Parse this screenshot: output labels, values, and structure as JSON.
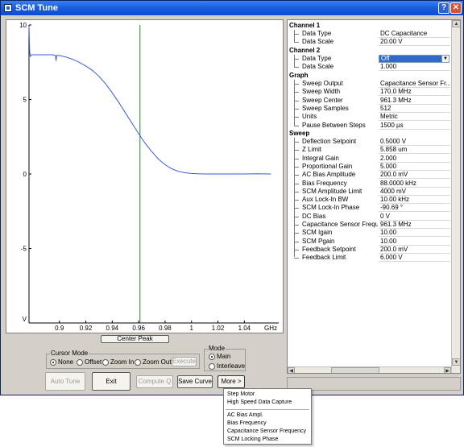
{
  "window": {
    "title": "SCM Tune",
    "help_label": "?",
    "close_label": "✕",
    "icon": "scm-app-icon"
  },
  "plot": {
    "center_peak_label": "Center Peak",
    "line_color": "#3a5bd9",
    "marker_color": "#1a8c1a"
  },
  "chart_data": {
    "type": "line",
    "xlabel": "GHz",
    "ylabel": "V",
    "xlim": [
      0.877,
      1.066
    ],
    "ylim": [
      -10,
      10
    ],
    "x_ticks": [
      "0.9",
      "0.92",
      "0.94",
      "0.96",
      "0.98",
      "1",
      "1.02",
      "1.04"
    ],
    "y_ticks": [
      "10",
      "5",
      "0",
      "-5"
    ],
    "cursor_x": 0.961,
    "series": [
      {
        "x": [
          0.877,
          0.8775,
          0.878,
          0.879,
          0.88,
          0.885,
          0.89,
          0.895,
          0.897,
          0.8975,
          0.898,
          0.9,
          0.905,
          0.91,
          0.915,
          0.92,
          0.925,
          0.93,
          0.935,
          0.94,
          0.945,
          0.95,
          0.955,
          0.96,
          0.965,
          0.97,
          0.975,
          0.98,
          0.985,
          0.99,
          0.995,
          1.0,
          1.005,
          1.01,
          1.015,
          1.02,
          1.03,
          1.04,
          1.05,
          1.06
        ],
        "y": [
          9.9,
          8.2,
          7.9,
          8.0,
          8.0,
          8.0,
          8.0,
          8.0,
          7.95,
          7.6,
          7.95,
          7.95,
          7.85,
          7.7,
          7.5,
          7.25,
          6.95,
          6.55,
          6.05,
          5.45,
          4.8,
          4.1,
          3.4,
          2.7,
          2.05,
          1.5,
          1.0,
          0.62,
          0.35,
          0.18,
          0.08,
          0.03,
          0.01,
          0.0,
          0.0,
          0.0,
          0.0,
          0.0,
          0.01,
          0.0
        ]
      }
    ]
  },
  "cursor_mode": {
    "title": "Cursor Mode",
    "options": [
      "None",
      "Offset",
      "Zoom In",
      "Zoom Out"
    ],
    "selected": "None",
    "execute_label": "Execute"
  },
  "mode": {
    "title": "Mode",
    "options": [
      "Main",
      "Interleave"
    ],
    "selected": "Main"
  },
  "buttons": {
    "auto_tune": "Auto Tune",
    "exit": "Exit",
    "compute_q": "Compute Q",
    "save_curve": "Save Curve",
    "more": "More >"
  },
  "properties": {
    "channel1": {
      "title": "Channel 1",
      "items": [
        {
          "name": "Data Type",
          "value": "DC Capacitance"
        },
        {
          "name": "Data Scale",
          "value": "20.00 V"
        }
      ]
    },
    "channel2": {
      "title": "Channel 2",
      "items": [
        {
          "name": "Data Type",
          "value": "Off"
        },
        {
          "name": "Data Scale",
          "value": "1.000"
        }
      ]
    },
    "graph": {
      "title": "Graph",
      "items": [
        {
          "name": "Sweep Output",
          "value": "Capacitance Sensor Fr..."
        },
        {
          "name": "Sweep Width",
          "value": "170.0 MHz"
        },
        {
          "name": "Sweep Center",
          "value": "961.3 MHz"
        },
        {
          "name": "Sweep Samples",
          "value": "512"
        },
        {
          "name": "Units",
          "value": "Metric"
        },
        {
          "name": "Pause Between Steps",
          "value": "1500 µs"
        }
      ]
    },
    "sweep": {
      "title": "Sweep",
      "items": [
        {
          "name": "Deflection Setpoint",
          "value": "0.5000 V"
        },
        {
          "name": "Z Limit",
          "value": "5.858 um"
        },
        {
          "name": "Integral Gain",
          "value": "2.000"
        },
        {
          "name": "Proportional Gain",
          "value": "5.000"
        },
        {
          "name": "AC Bias Amplitude",
          "value": "200.0 mV"
        },
        {
          "name": "Bias Frequency",
          "value": "88.0000 kHz"
        },
        {
          "name": "SCM Amplitude Limit",
          "value": "4000 mV"
        },
        {
          "name": "Aux Lock-In BW",
          "value": "10.00 kHz"
        },
        {
          "name": "SCM Lock-In Phase",
          "value": "-90.69 °"
        },
        {
          "name": "DC Bias",
          "value": "0 V"
        },
        {
          "name": "Capacitance Sensor Frequency",
          "value": "961.3 MHz"
        },
        {
          "name": "SCM Igain",
          "value": "10.00"
        },
        {
          "name": "SCM Pgain",
          "value": "10.00"
        },
        {
          "name": "Feedback Setpoint",
          "value": "200.0 mV"
        },
        {
          "name": "Feedback Limit",
          "value": "6.000 V"
        }
      ]
    }
  },
  "more_menu": {
    "group1": [
      "Step Motor",
      "High Speed Data Capture"
    ],
    "group2": [
      "AC Bias Ampl.",
      "Bias Frequency",
      "Capacitance Sensor Frequency",
      "SCM Locking Phase"
    ]
  }
}
